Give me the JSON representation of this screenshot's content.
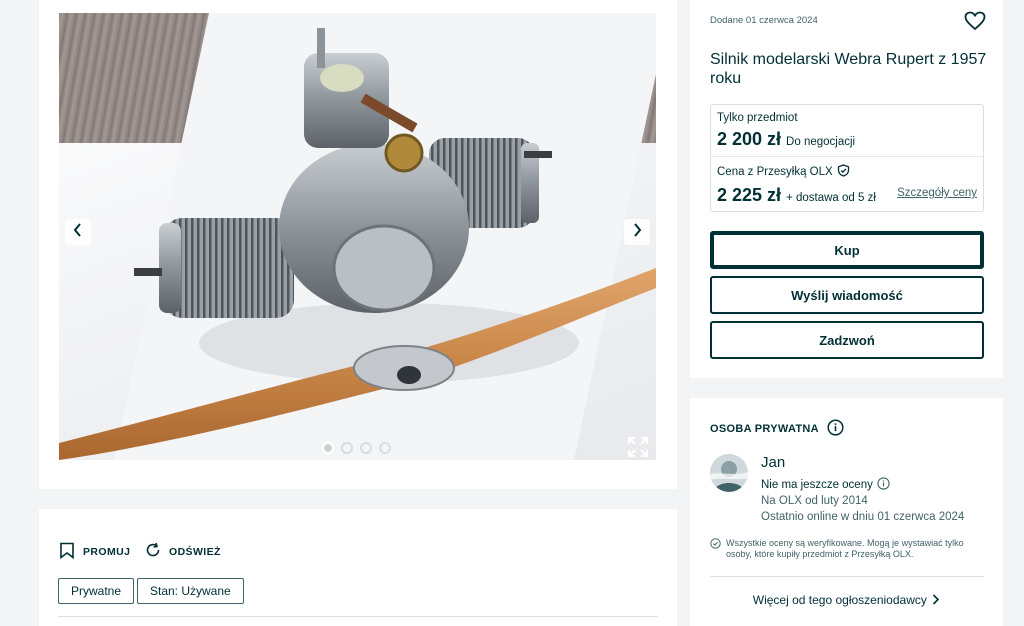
{
  "gallery": {
    "prev_icon": "chevron-left-icon",
    "next_icon": "chevron-right-icon",
    "expand_icon": "expand-icon",
    "image_count": 4,
    "active_index": 0
  },
  "actions": {
    "promote_label": "PROMUJ",
    "refresh_label": "ODŚWIEŻ"
  },
  "tags": [
    "Prywatne",
    "Stan: Używane"
  ],
  "offer": {
    "date": "Dodane 01 czerwca 2024",
    "title": "Silnik modelarski Webra Rupert z 1957 roku",
    "item_only_label": "Tylko przedmiot",
    "item_only_price": "2 200 zł",
    "negotiable": "Do negocjacji",
    "shipping_label": "Cena z Przesyłką OLX",
    "shipping_price": "2 225 zł",
    "shipping_note": "+ dostawa od 5 zł",
    "price_details": "Szczegóły ceny",
    "buy_button": "Kup",
    "message_button": "Wyślij wiadomość",
    "call_button": "Zadzwoń"
  },
  "seller": {
    "type_label": "OSOBA PRYWATNA",
    "name": "Jan",
    "rating": "Nie ma jeszcze oceny",
    "member_since": "Na OLX od luty 2014",
    "last_online": "Ostatnio online w dniu 01 czerwca 2024",
    "verify_note": "Wszystkie oceny są weryfikowane. Mogą je wystawiać tylko osoby, które kupiły przedmiot z Przesyłką OLX.",
    "more_link": "Więcej od tego ogłoszeniodawcy"
  },
  "colors": {
    "brand_dark": "#002f34",
    "muted": "#406367",
    "border": "#d8dfe0",
    "background": "#f2f4f5"
  }
}
